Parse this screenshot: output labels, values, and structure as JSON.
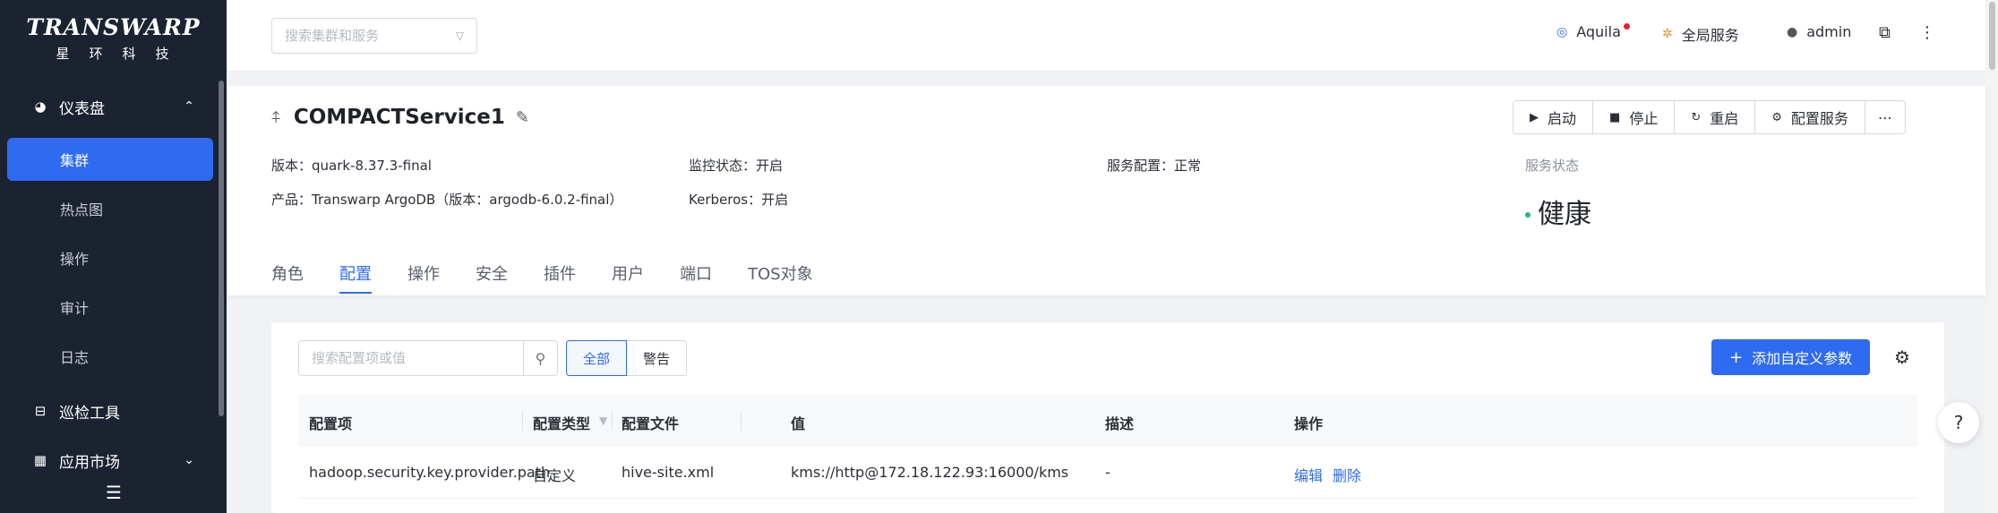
{
  "brand": {
    "name": "TRANSWARP",
    "sub": "星环科技"
  },
  "sidebar": {
    "dashboard": {
      "label": "仪表盘",
      "icon": "dashboard-icon"
    },
    "items": [
      {
        "label": "集群",
        "active": true
      },
      {
        "label": "热点图"
      },
      {
        "label": "操作"
      },
      {
        "label": "审计"
      },
      {
        "label": "日志"
      }
    ],
    "inspection": {
      "label": "巡检工具",
      "icon": "inspection-icon"
    },
    "market": {
      "label": "应用市场",
      "icon": "grid-icon"
    }
  },
  "header": {
    "search_placeholder": "搜索集群和服务",
    "aquila": "Aquila",
    "global_services": "全局服务",
    "user": "admin"
  },
  "service": {
    "name": "COMPACTService1",
    "version_label": "版本：",
    "version": "quark-8.37.3-final",
    "product_label": "产品：",
    "product": "Transwarp ArgoDB（版本：argodb-6.0.2-final）",
    "monitor_label": "监控状态：",
    "monitor": "开启",
    "kerberos_label": "Kerberos：",
    "kerberos": "开启",
    "config_label": "服务配置：",
    "config": "正常",
    "status_label": "服务状态",
    "status": "健康",
    "status_color": "#1fb77a"
  },
  "actions": {
    "start": "启动",
    "stop": "停止",
    "restart": "重启",
    "configure": "配置服务",
    "more": "⋯"
  },
  "tabs": [
    "角色",
    "配置",
    "操作",
    "安全",
    "插件",
    "用户",
    "端口",
    "TOS对象"
  ],
  "active_tab": "配置",
  "config": {
    "search_placeholder": "搜索配置项或值",
    "filter_all": "全部",
    "filter_warn": "警告",
    "add_button": "添加自定义参数",
    "columns": [
      "配置项",
      "配置类型",
      "配置文件",
      "值",
      "描述",
      "操作"
    ],
    "rows": [
      {
        "key": "hadoop.security.key.provider.path",
        "type": "自定义",
        "file": "hive-site.xml",
        "value": "kms://http@172.18.122.93:16000/kms",
        "desc": "-",
        "edit": "编辑",
        "delete": "删除"
      }
    ]
  },
  "colors": {
    "accent": "#2e6bf0",
    "sidebar": "#1b2331"
  }
}
